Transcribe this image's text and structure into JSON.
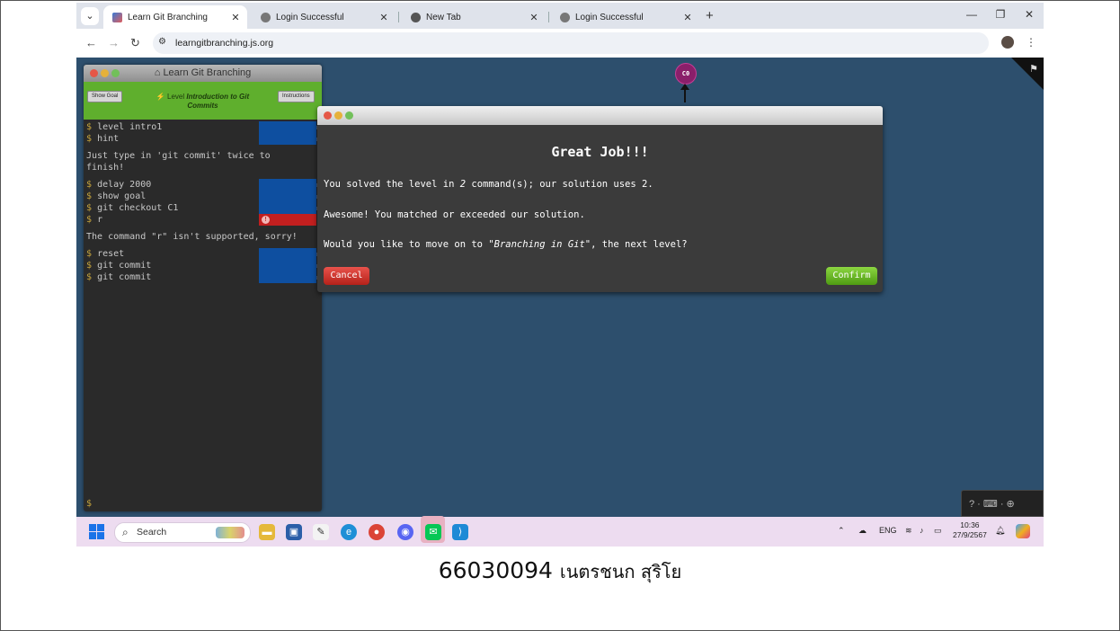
{
  "browser": {
    "tabs": [
      {
        "title": "Learn Git Branching",
        "active": true,
        "favicon": "learngit-favicon"
      },
      {
        "title": "Login Successful",
        "active": false,
        "favicon": "globe-icon"
      },
      {
        "title": "New Tab",
        "active": false,
        "favicon": "chrome-icon"
      },
      {
        "title": "Login Successful",
        "active": false,
        "favicon": "globe-icon"
      }
    ],
    "url": "learngitbranching.js.org"
  },
  "terminal": {
    "title": "Learn Git Branching",
    "show_goal": "Show Goal",
    "instructions": "Instructions",
    "level_prefix": "Level",
    "level_name": "Introduction to Git Commits",
    "lines": [
      {
        "cmd": "level intro1",
        "status": "ok"
      },
      {
        "cmd": "hint",
        "status": "ok"
      }
    ],
    "hint_output": "Just type in 'git commit' twice to finish!",
    "lines2": [
      {
        "cmd": "delay 2000",
        "status": "ok"
      },
      {
        "cmd": "show goal",
        "status": "ok"
      },
      {
        "cmd": "git checkout C1",
        "status": "ok"
      },
      {
        "cmd": "r",
        "status": "error"
      }
    ],
    "error_output": "The command \"r\" isn't supported, sorry!",
    "lines3": [
      {
        "cmd": "reset",
        "status": "ok"
      },
      {
        "cmd": "git commit",
        "status": "ok"
      },
      {
        "cmd": "git commit",
        "status": "ok"
      }
    ],
    "prompt": "$"
  },
  "graph": {
    "commit_label": "C0",
    "help_text": "? · ⌨ · ⊕"
  },
  "modal": {
    "heading": "Great Job!!!",
    "line1_pre": "You solved the level in ",
    "line1_num": "2",
    "line1_post": " command(s); our solution uses 2.",
    "line2": "Awesome! You matched or exceeded our solution.",
    "line3_pre": "Would you like to move on to ",
    "line3_level": "\"Branching in Git\"",
    "line3_post": ", the next level?",
    "cancel": "Cancel",
    "confirm": "Confirm"
  },
  "taskbar": {
    "search": "Search",
    "lang": "ENG",
    "time": "10:36",
    "date": "27/9/2567"
  },
  "caption": {
    "id": "66030094",
    "name": "เนตรชนก สุริโย"
  },
  "colors": {
    "canvas": "#2d4f6d",
    "toolbar_green": "#5faf2d",
    "commit": "#8a1f6a",
    "status_ok": "#0e4fa0",
    "status_err": "#c21f1f"
  }
}
